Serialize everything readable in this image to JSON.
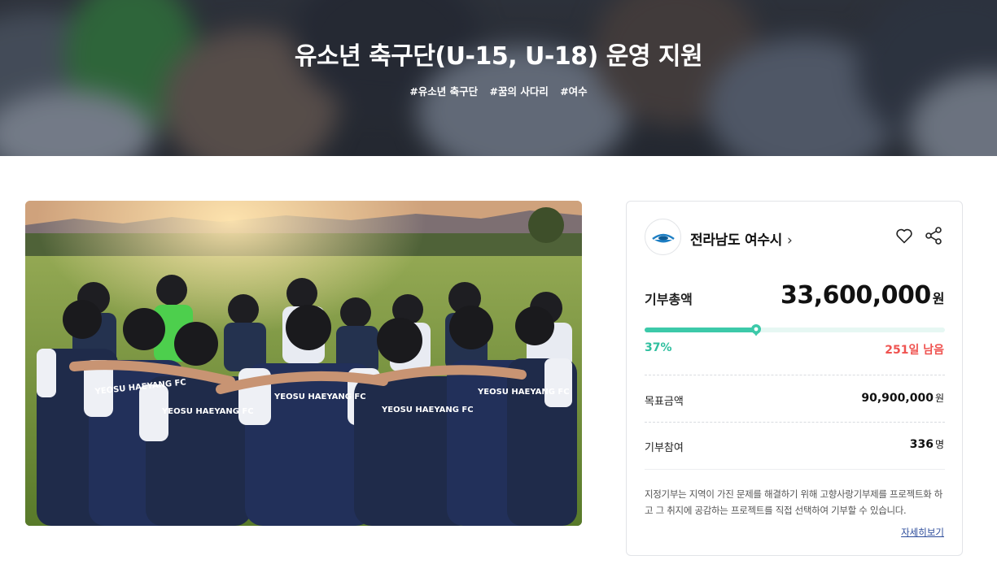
{
  "hero": {
    "title": "유소년 축구단(U-15, U-18) 운영 지원",
    "tags": [
      "#유소년 축구단",
      "#꿈의 사다리",
      "#여수"
    ]
  },
  "photo": {
    "alt": "YEOSU HAEYANG FC",
    "jersey_text": "YEOSU HAEYANG FC"
  },
  "card": {
    "org_name": "전라남도 여수시",
    "chevron": "›",
    "total_label": "기부총액",
    "total_amount": "33,600,000",
    "total_unit": "원",
    "progress": 0.37,
    "progress_text": "37%",
    "days_left": "251일 남음",
    "goal_label": "목표금액",
    "goal_amount": "90,900,000",
    "goal_unit": "원",
    "participants_label": "기부참여",
    "participants_count": "336",
    "participants_unit": "명",
    "info_text": "지정기부는 지역이 가진 문제를 해결하기 위해 고향사랑기부제를 프로젝트화 하고 그 취지에 공감하는 프로젝트를 직접 선택하여 기부할 수 있습니다.",
    "more_link": "자세히보기"
  },
  "colors": {
    "accent_teal": "#3cc9a9",
    "days_red": "#ef5350",
    "link_blue": "#2a4a9a"
  },
  "icons": [
    "heart-icon",
    "share-icon",
    "chevron-right-icon",
    "map-pin-icon",
    "city-logo-icon"
  ]
}
